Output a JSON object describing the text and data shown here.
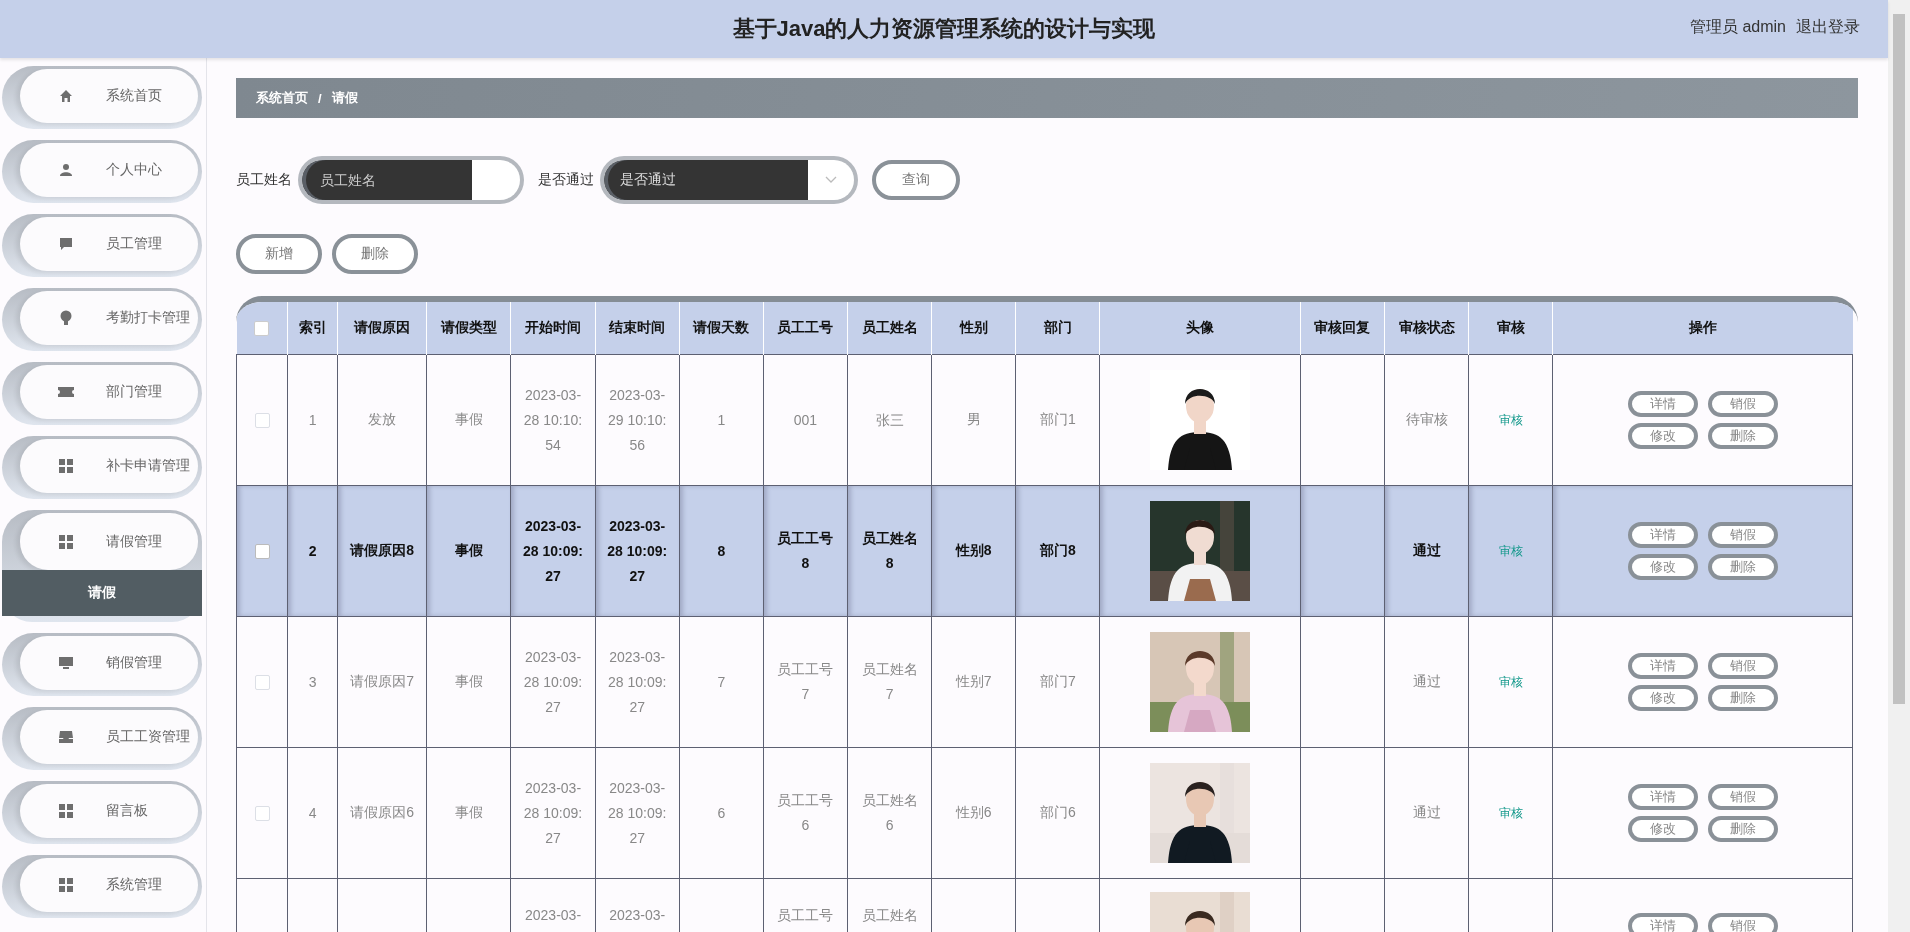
{
  "header": {
    "title": "基于Java的人力资源管理系统的设计与实现",
    "user": "管理员 admin",
    "logout": "退出登录"
  },
  "sidebar": {
    "items": [
      {
        "label": "系统首页",
        "expanded": false
      },
      {
        "label": "个人中心",
        "expanded": false
      },
      {
        "label": "员工管理",
        "expanded": false
      },
      {
        "label": "考勤打卡管理",
        "expanded": false
      },
      {
        "label": "部门管理",
        "expanded": false
      },
      {
        "label": "补卡申请管理",
        "expanded": false
      },
      {
        "label": "请假管理",
        "expanded": true,
        "children": [
          {
            "label": "请假",
            "selected": true
          }
        ]
      },
      {
        "label": "销假管理",
        "expanded": false
      },
      {
        "label": "员工工资管理",
        "expanded": false
      },
      {
        "label": "留言板",
        "expanded": false
      },
      {
        "label": "系统管理",
        "expanded": false
      }
    ]
  },
  "breadcrumb": {
    "items": [
      "系统首页",
      "请假"
    ],
    "separator": "/"
  },
  "search": {
    "fields": [
      {
        "kind": "text",
        "label": "员工姓名",
        "placeholder": "员工姓名"
      },
      {
        "kind": "select",
        "label": "是否通过",
        "placeholder": "是否通过"
      }
    ],
    "button": "查询"
  },
  "actions": [
    "新增",
    "删除"
  ],
  "table": {
    "header_checkbox": {
      "checked": false
    },
    "columns": [
      "索引",
      "请假原因",
      "请假类型",
      "开始时间",
      "结束时间",
      "请假天数",
      "员工工号",
      "员工姓名",
      "性别",
      "部门",
      "头像",
      "审核回复",
      "审核状态",
      "审核",
      "操作"
    ],
    "rows": [
      {
        "kind": "full",
        "selected": false,
        "checked": false,
        "index": "1",
        "reason": "发放",
        "type": "事假",
        "start": "2023-03-28 10:10:54",
        "end": "2023-03-29 10:10:56",
        "days": "1",
        "emp_no": "001",
        "emp_name": "张三",
        "gender": "男",
        "dept": "部门1",
        "status": "待审核",
        "audit": "审核",
        "actions": [
          "详情",
          "销假",
          "修改",
          "删除"
        ]
      },
      {
        "kind": "full",
        "selected": true,
        "checked": false,
        "index": "2",
        "reason": "请假原因8",
        "type": "事假",
        "start": "2023-03-28 10:09:27",
        "end": "2023-03-28 10:09:27",
        "days": "8",
        "emp_no": "员工工号8",
        "emp_name": "员工姓名8",
        "gender": "性别8",
        "dept": "部门8",
        "status": "通过",
        "audit": "审核",
        "actions": [
          "详情",
          "销假",
          "修改",
          "删除"
        ]
      },
      {
        "kind": "full",
        "selected": false,
        "checked": false,
        "index": "3",
        "reason": "请假原因7",
        "type": "事假",
        "start": "2023-03-28 10:09:27",
        "end": "2023-03-28 10:09:27",
        "days": "7",
        "emp_no": "员工工号7",
        "emp_name": "员工姓名7",
        "gender": "性别7",
        "dept": "部门7",
        "status": "通过",
        "audit": "审核",
        "actions": [
          "详情",
          "销假",
          "修改",
          "删除"
        ]
      },
      {
        "kind": "full",
        "selected": false,
        "checked": false,
        "index": "4",
        "reason": "请假原因6",
        "type": "事假",
        "start": "2023-03-28 10:09:27",
        "end": "2023-03-28 10:09:27",
        "days": "6",
        "emp_no": "员工工号6",
        "emp_name": "员工姓名6",
        "gender": "性别6",
        "dept": "部门6",
        "status": "通过",
        "audit": "审核",
        "actions": [
          "详情",
          "销假",
          "修改",
          "删除"
        ]
      },
      {
        "kind": "partial",
        "selected": false,
        "start": "2023-03-",
        "end": "2023-03-",
        "emp_no": "员工工号",
        "emp_name": "员工姓名",
        "actions": [
          "详情",
          "销假"
        ]
      }
    ]
  }
}
